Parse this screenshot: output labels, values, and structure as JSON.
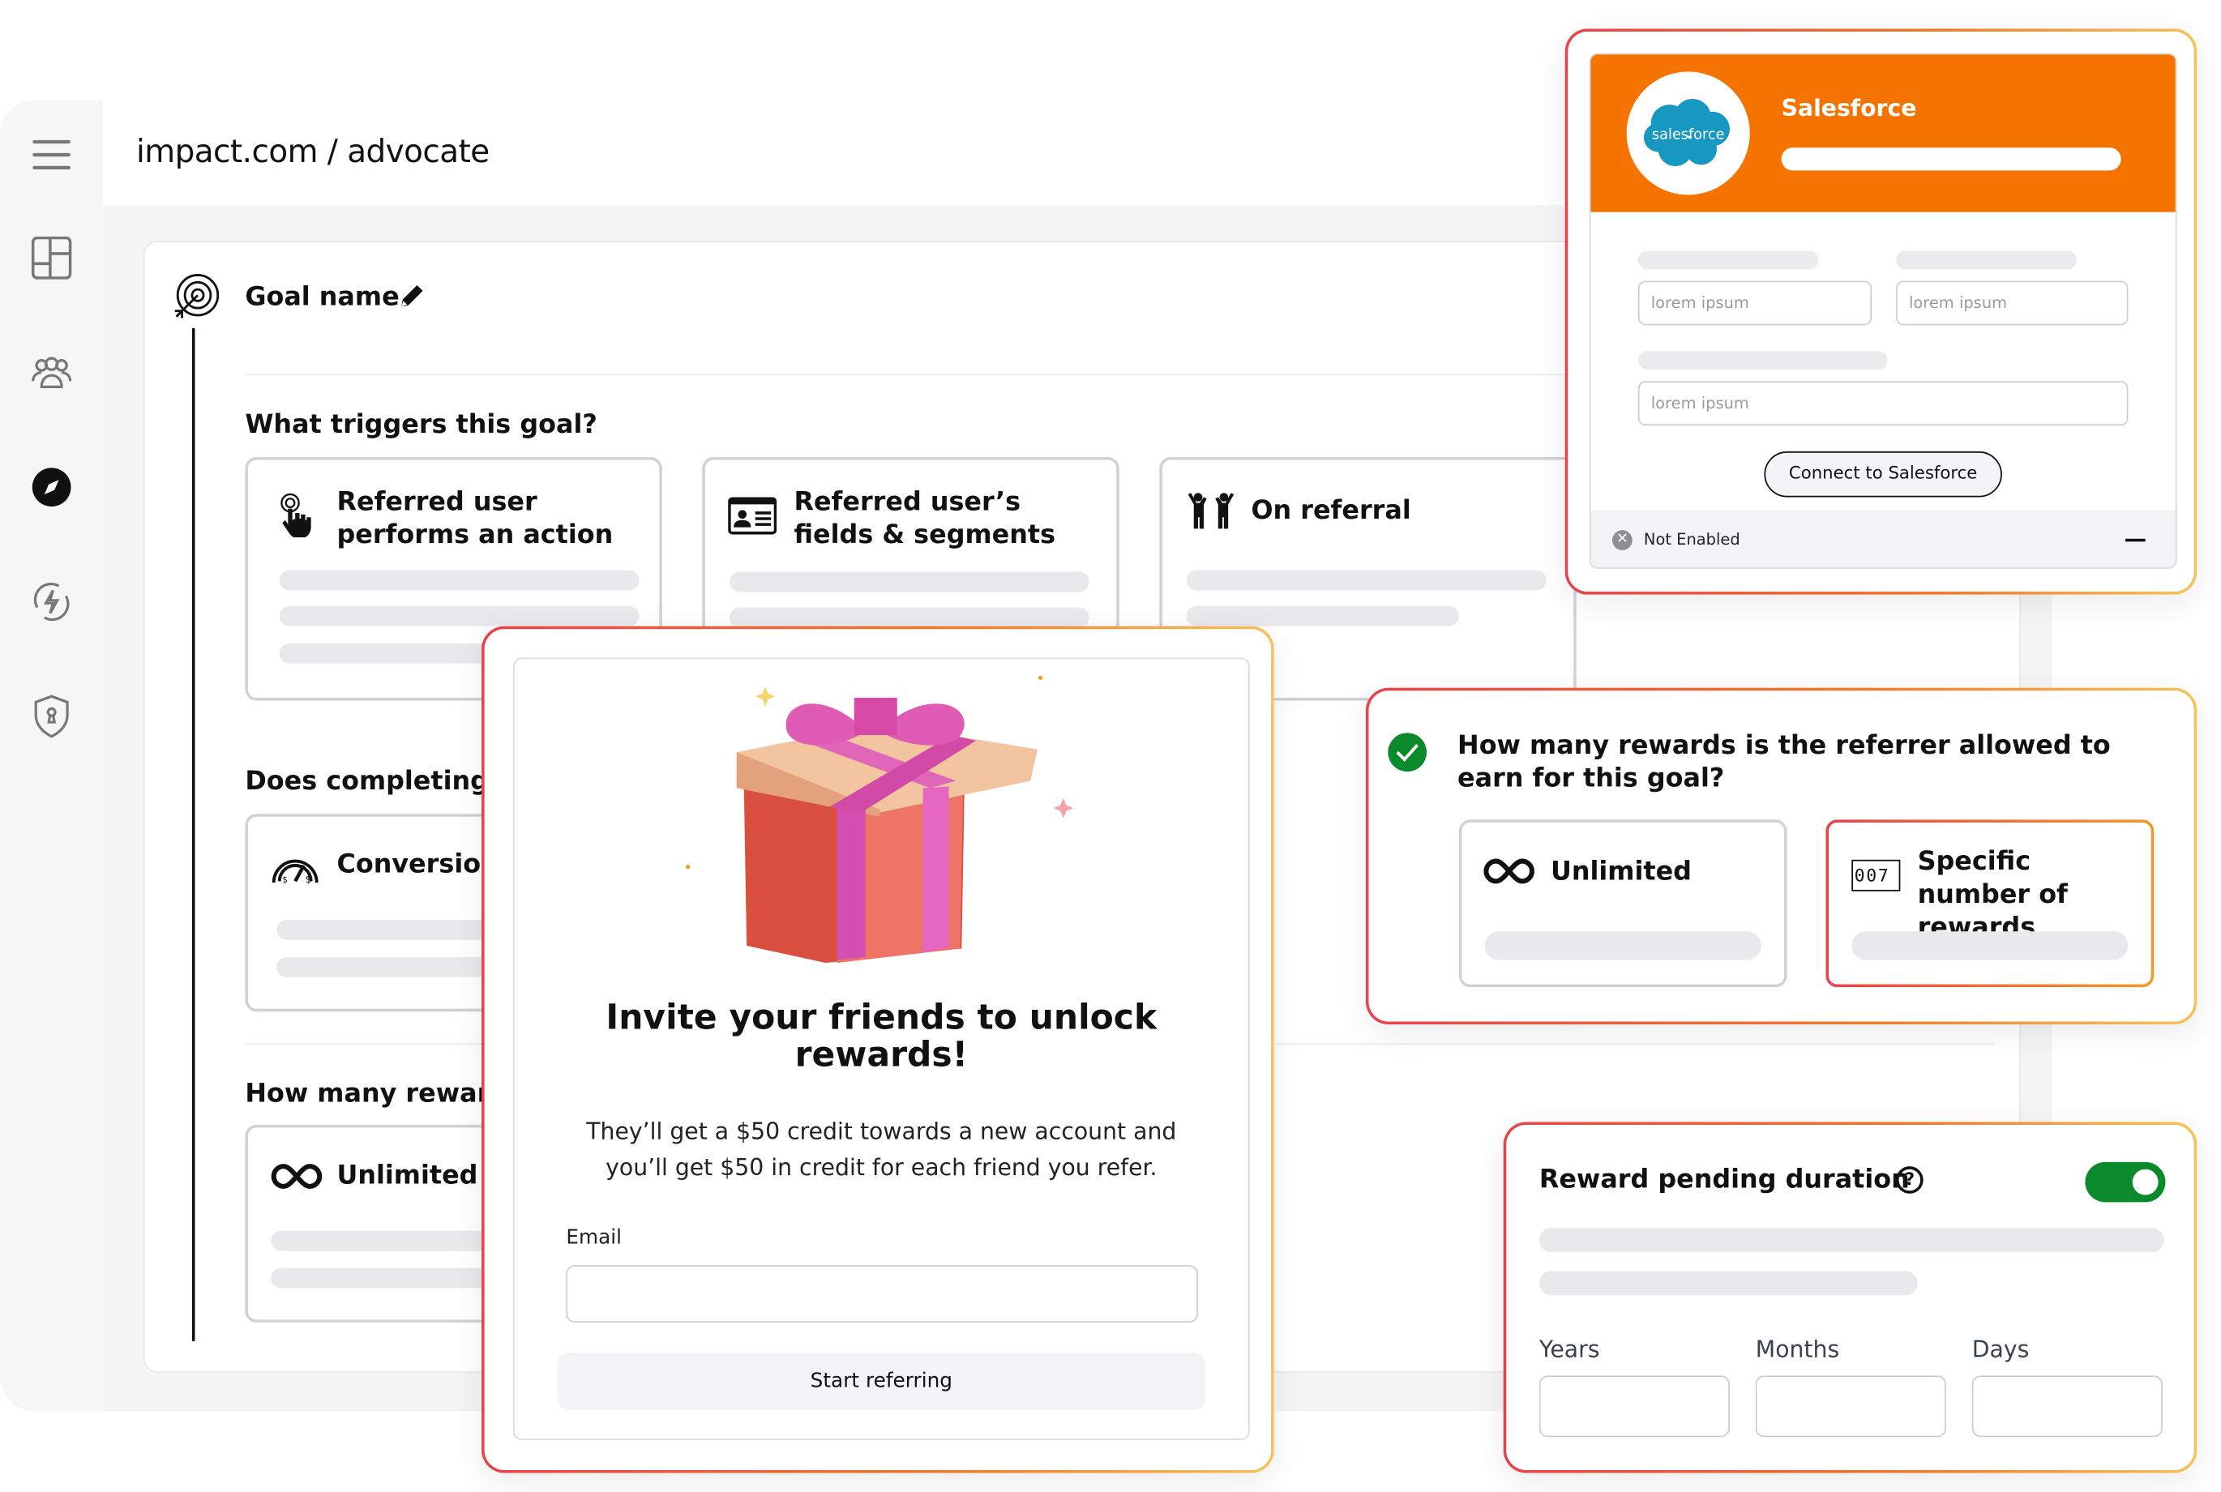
{
  "app": {
    "title": "impact.com / advocate"
  },
  "sidebar": {
    "items": [
      {
        "icon": "menu-icon"
      },
      {
        "icon": "dashboard-grid-icon"
      },
      {
        "icon": "people-icon"
      },
      {
        "icon": "compass-icon",
        "active": true
      },
      {
        "icon": "bolt-refresh-icon"
      },
      {
        "icon": "shield-keyhole-icon"
      }
    ]
  },
  "goal": {
    "name": "Goal name",
    "triggers_question": "What triggers this goal?",
    "triggers": [
      {
        "label": "Referred user performs an action",
        "icon": "tap-hand-icon"
      },
      {
        "label": "Referred user’s fields & segments",
        "icon": "id-card-icon"
      },
      {
        "label": "On referral",
        "icon": "people-cheer-icon"
      }
    ],
    "completion_question": "Does completing th",
    "completion_option": "Conversion",
    "rewards_question": "How many rewards",
    "rewards_option": "Unlimited"
  },
  "invite_modal": {
    "heading": "Invite your friends to unlock rewards!",
    "body": "They’ll get a $50 credit towards a new account and you’ll get $50 in credit for each friend you refer.",
    "email_label": "Email",
    "email_value": "",
    "button": "Start referring"
  },
  "salesforce": {
    "title": "Salesforce",
    "logo_text": "salesforce",
    "brand_color": "#f57300",
    "logo_color": "#1798c1",
    "inputs": [
      "lorem ipsum",
      "lorem ipsum",
      "lorem ipsum"
    ],
    "connect_button": "Connect to Salesforce",
    "status": "Not Enabled"
  },
  "rewards_limit": {
    "question": "How many rewards is the referrer allowed to earn for this goal?",
    "options": [
      {
        "label": "Unlimited",
        "icon": "infinity-icon",
        "selected": false
      },
      {
        "label": "Specific number of rewards",
        "icon": "counter-icon",
        "counter": "007",
        "selected": true
      }
    ],
    "completed_color": "#0a8a2a"
  },
  "pending": {
    "title": "Reward pending duration",
    "toggle_on": true,
    "toggle_color": "#0a8a2a",
    "fields": [
      {
        "label": "Years",
        "value": ""
      },
      {
        "label": "Months",
        "value": ""
      },
      {
        "label": "Days",
        "value": ""
      }
    ]
  }
}
